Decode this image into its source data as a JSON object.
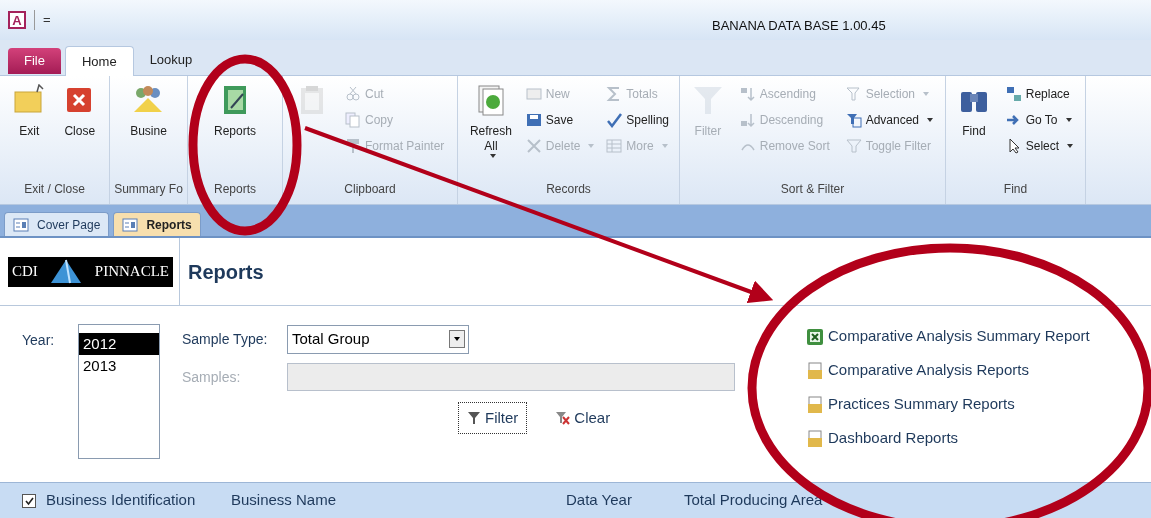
{
  "window": {
    "title": "BANANA DATA BASE 1.00.45",
    "app_letter": "A",
    "quick_access": "="
  },
  "ribbon_tabs": [
    {
      "label": "File",
      "kind": "file",
      "selected": false
    },
    {
      "label": "Home",
      "kind": "tab",
      "selected": true
    },
    {
      "label": "Lookup",
      "kind": "tab",
      "selected": false
    }
  ],
  "ribbon_groups": [
    {
      "label": "Exit / Close",
      "columns": [
        {
          "kind": "large",
          "items": [
            {
              "label": "Exit",
              "disabled": false,
              "menu": false
            }
          ]
        },
        {
          "kind": "large",
          "items": [
            {
              "label": "Close",
              "disabled": false,
              "menu": false
            }
          ]
        }
      ]
    },
    {
      "label": "Summary Fo",
      "columns": [
        {
          "kind": "large",
          "items": [
            {
              "label": "Busine",
              "disabled": false,
              "menu": false
            }
          ]
        }
      ]
    },
    {
      "label": "Reports",
      "columns": [
        {
          "kind": "large",
          "items": [
            {
              "label": "Reports",
              "disabled": false,
              "menu": false
            }
          ]
        }
      ]
    },
    {
      "label": "Clipboard",
      "columns": [
        {
          "kind": "large",
          "items": [
            {
              "disabled": true,
              "menu": false
            }
          ]
        },
        {
          "kind": "small",
          "items": [
            {
              "label": "Cut",
              "disabled": true,
              "menu": false
            },
            {
              "label": "Copy",
              "disabled": true,
              "menu": false
            },
            {
              "label": "Format Painter",
              "disabled": true,
              "menu": false
            }
          ]
        }
      ]
    },
    {
      "label": "Records",
      "columns": [
        {
          "kind": "large",
          "items": [
            {
              "label": "Refresh All",
              "disabled": false,
              "menu": true
            }
          ]
        },
        {
          "kind": "small",
          "items": [
            {
              "label": "New",
              "disabled": true,
              "menu": false
            },
            {
              "label": "Save",
              "disabled": false,
              "menu": false
            },
            {
              "label": "Delete",
              "disabled": true,
              "menu": true
            }
          ]
        },
        {
          "kind": "small",
          "items": [
            {
              "label": "Totals",
              "disabled": true,
              "menu": false
            },
            {
              "label": "Spelling",
              "disabled": false,
              "menu": false
            },
            {
              "label": "More",
              "disabled": true,
              "menu": true
            }
          ]
        }
      ]
    },
    {
      "label": "Sort & Filter",
      "columns": [
        {
          "kind": "large",
          "items": [
            {
              "label": "Filter",
              "disabled": true,
              "menu": false
            }
          ]
        },
        {
          "kind": "small",
          "items": [
            {
              "label": "Ascending",
              "disabled": true,
              "menu": false
            },
            {
              "label": "Descending",
              "disabled": true,
              "menu": false
            },
            {
              "label": "Remove Sort",
              "disabled": true,
              "menu": false
            }
          ]
        },
        {
          "kind": "small",
          "items": [
            {
              "label": "Selection",
              "disabled": true,
              "menu": true
            },
            {
              "label": "Advanced",
              "disabled": false,
              "menu": true
            },
            {
              "label": "Toggle Filter",
              "disabled": true,
              "menu": false
            }
          ]
        }
      ]
    },
    {
      "label": "Find",
      "columns": [
        {
          "kind": "large",
          "items": [
            {
              "label": "Find",
              "disabled": false,
              "menu": false
            }
          ]
        },
        {
          "kind": "small",
          "items": [
            {
              "label": "Replace",
              "disabled": false,
              "menu": false
            },
            {
              "label": "Go To",
              "disabled": false,
              "menu": true
            },
            {
              "label": "Select",
              "disabled": false,
              "menu": true
            }
          ]
        }
      ]
    }
  ],
  "document_tabs": [
    {
      "label": "Cover Page",
      "selected": false
    },
    {
      "label": "Reports",
      "selected": true
    }
  ],
  "form": {
    "logo": {
      "left": "CDI",
      "right": "PINNACLE"
    },
    "title": "Reports",
    "year": {
      "label": "Year:",
      "options": [
        {
          "label": "2012",
          "selected": true
        },
        {
          "label": "2013",
          "selected": false
        }
      ]
    },
    "sample_type": {
      "label": "Sample Type:",
      "value": "Total Group"
    },
    "samples": {
      "label": "Samples:",
      "disabled": true
    },
    "buttons": [
      {
        "label": "Filter",
        "kind": "filter"
      },
      {
        "label": "Clear",
        "kind": "clear"
      }
    ],
    "report_links": [
      {
        "label": "Comparative Analysis Summary Report",
        "kind": "spreadsheet"
      },
      {
        "label": "Comparative Analysis Reports",
        "kind": "report"
      },
      {
        "label": "Practices Summary Reports",
        "kind": "report"
      },
      {
        "label": "Dashboard Reports",
        "kind": "report"
      }
    ]
  },
  "table": {
    "select_all_checked": true,
    "columns": [
      "Business Identification",
      "Business Name",
      "Data Year",
      "Total Producing Area"
    ]
  }
}
